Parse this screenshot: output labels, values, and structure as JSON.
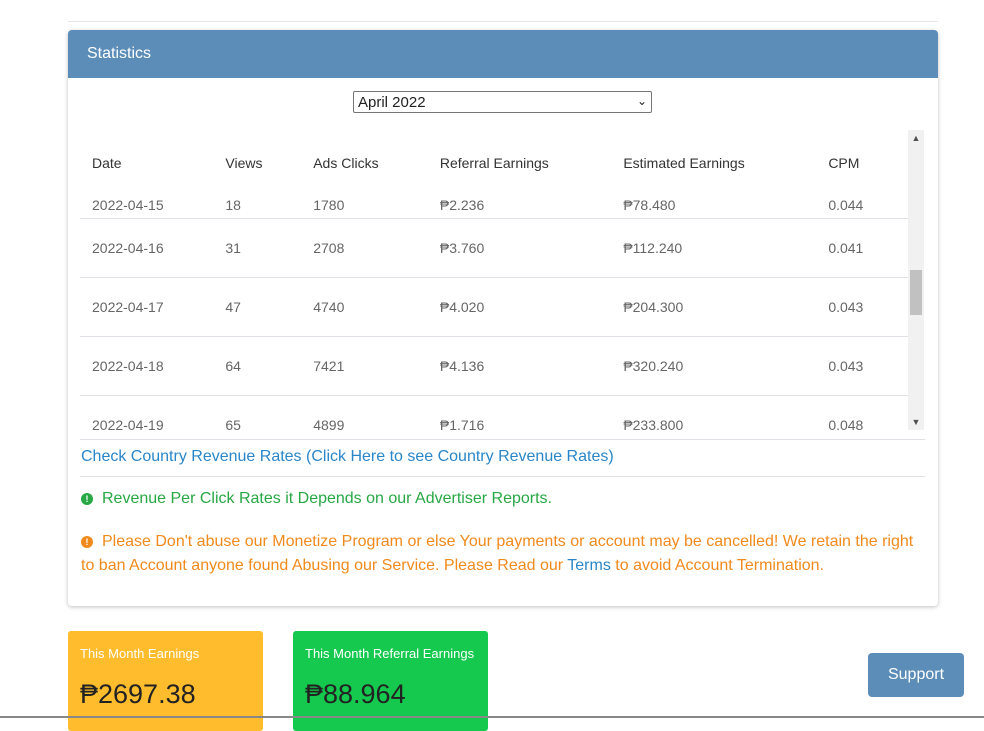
{
  "panel": {
    "title": "Statistics"
  },
  "month_select": {
    "value": "April 2022"
  },
  "table": {
    "headers": [
      "Date",
      "Views",
      "Ads Clicks",
      "Referral Earnings",
      "Estimated Earnings",
      "CPM"
    ],
    "rows": [
      [
        "2022-04-15",
        "18",
        "1780",
        "₱2.236",
        "₱78.480",
        "0.044"
      ],
      [
        "2022-04-16",
        "31",
        "2708",
        "₱3.760",
        "₱112.240",
        "0.041"
      ],
      [
        "2022-04-17",
        "47",
        "4740",
        "₱4.020",
        "₱204.300",
        "0.043"
      ],
      [
        "2022-04-18",
        "64",
        "7421",
        "₱4.136",
        "₱320.240",
        "0.043"
      ],
      [
        "2022-04-19",
        "65",
        "4899",
        "₱1.716",
        "₱233.800",
        "0.048"
      ]
    ]
  },
  "country_link": "Check Country Revenue Rates (Click Here to see Country Revenue Rates)",
  "notices": {
    "green": "Revenue Per Click Rates it Depends on our Advertiser Reports.",
    "orange_part1": "Please Don't abuse our Monetize Program or else Your payments or account may be cancelled! We retain the right to ban Account anyone found Abusing our Service. Please Read our ",
    "terms_link": "Terms",
    "orange_part2": " to avoid Account Termination."
  },
  "cards": {
    "month_earnings": {
      "title": "This Month Earnings",
      "value": "₱2697.38"
    },
    "referral_earnings": {
      "title": "This Month Referral Earnings",
      "value": "₱88.964"
    }
  },
  "support_button": "Support",
  "colors": {
    "header": "#5b8db8",
    "yellow_card": "#ffbd2e",
    "green_card": "#14c94e",
    "link": "#2a86c8",
    "warning": "#f08a1c",
    "success": "#28a745"
  }
}
